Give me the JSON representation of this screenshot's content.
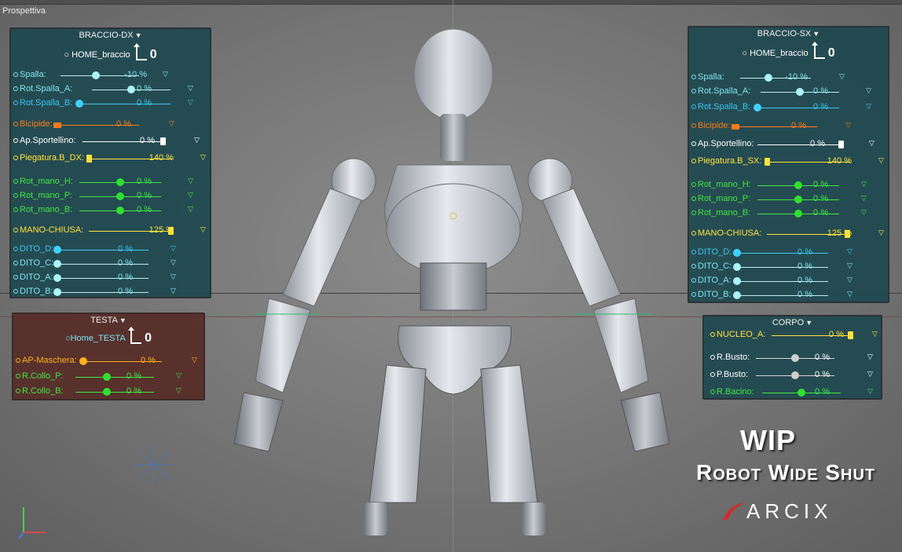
{
  "viewport": {
    "label": "Prospettiva"
  },
  "panels": {
    "braccio_dx": {
      "title": "BRACCIO-DX",
      "home_label": "HOME_braccio",
      "home_value": "0",
      "rows": [
        {
          "label": "Spalla:",
          "value": "-10 %"
        },
        {
          "label": "Rot.Spalla_A:",
          "value": "0 %"
        },
        {
          "label": "Rot.Spalla_B:",
          "value": "0 %"
        },
        {
          "label": "Bicipide:",
          "value": "0 %"
        },
        {
          "label": "Ap.Sportellino:",
          "value": "0 %"
        },
        {
          "label": "Piegatura.B_DX:",
          "value": "140 %"
        },
        {
          "label": "Rot_mano_H:",
          "value": "0 %"
        },
        {
          "label": "Rot_mano_P:",
          "value": "0 %"
        },
        {
          "label": "Rot_mano_B:",
          "value": "0 %"
        },
        {
          "label": "MANO-CHIUSA:",
          "value": "125 %"
        },
        {
          "label": "DITO_D:",
          "value": "0 %"
        },
        {
          "label": "DITO_C:",
          "value": "0 %"
        },
        {
          "label": "DITO_A:",
          "value": "0 %"
        },
        {
          "label": "DITO_B:",
          "value": "0 %"
        }
      ]
    },
    "braccio_sx": {
      "title": "BRACCIO-SX",
      "home_label": "HOME_braccio",
      "home_value": "0",
      "rows": [
        {
          "label": "Spalla:",
          "value": "-10 %"
        },
        {
          "label": "Rot.Spalla_A:",
          "value": "0 %"
        },
        {
          "label": "Rot.Spalla_B:",
          "value": "0 %"
        },
        {
          "label": "Bicipide:",
          "value": "0 %"
        },
        {
          "label": "Ap.Sportellino:",
          "value": "0 %"
        },
        {
          "label": "Piegatura.B_SX:",
          "value": "140 %"
        },
        {
          "label": "Rot_mano_H:",
          "value": "0 %"
        },
        {
          "label": "Rot_mano_P:",
          "value": "0 %"
        },
        {
          "label": "Rot_mano_B:",
          "value": "0 %"
        },
        {
          "label": "MANO-CHIUSA:",
          "value": "125 %"
        },
        {
          "label": "DITO_D:",
          "value": "0 %"
        },
        {
          "label": "DITO_C:",
          "value": "0 %"
        },
        {
          "label": "DITO_A:",
          "value": "0 %"
        },
        {
          "label": "DITO_B:",
          "value": "0 %"
        }
      ]
    },
    "testa": {
      "title": "TESTA",
      "home_label": "Home_TESTA",
      "home_value": "0",
      "rows": [
        {
          "label": "AP-Maschera:",
          "value": "0 %"
        },
        {
          "label": "R.Collo_P:",
          "value": "0 %"
        },
        {
          "label": "R.Collo_B:",
          "value": "0 %"
        }
      ]
    },
    "corpo": {
      "title": "CORPO",
      "rows": [
        {
          "label": "NUCLEO_A:",
          "value": "0 %"
        },
        {
          "label": "R.Busto:",
          "value": "0 %"
        },
        {
          "label": "P.Busto:",
          "value": "0 %"
        },
        {
          "label": "R.Bacino:",
          "value": "0 %"
        }
      ]
    }
  },
  "overlay": {
    "wip": "WIP",
    "title": "Robot Wide Shut",
    "brand": "ARCIX"
  },
  "icons": [
    "dropdown-triangle-icon",
    "home-arrow-icon",
    "axis-gizmo-icon",
    "light-icon"
  ]
}
